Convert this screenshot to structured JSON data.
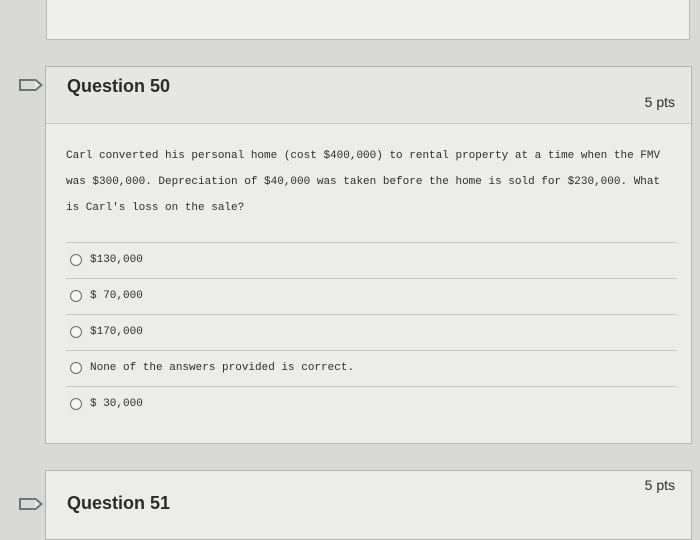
{
  "questions": [
    {
      "title": "Question 50",
      "points": "5 pts",
      "text": "Carl converted his personal home (cost $400,000) to rental property at a time when the FMV was $300,000. Depreciation of $40,000 was taken before the home is sold for $230,000. What is Carl's loss on the sale?",
      "options": [
        "$130,000",
        "$ 70,000",
        "$170,000",
        "None of the answers provided is correct.",
        "$ 30,000"
      ]
    },
    {
      "title": "Question 51",
      "points": "5 pts"
    }
  ]
}
